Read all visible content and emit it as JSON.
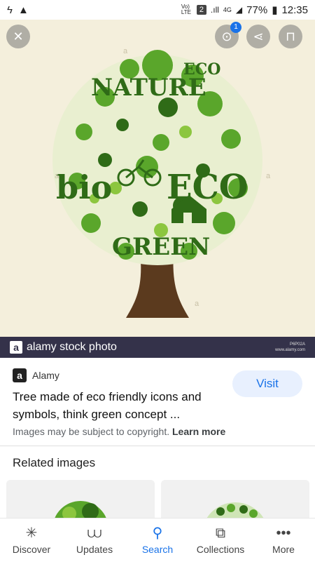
{
  "status_bar": {
    "time": "12:35",
    "battery": "77%",
    "network": "4G",
    "volte": "Vo) LTE",
    "sim_slot": "2"
  },
  "viewer": {
    "close_icon": "close-icon",
    "lens_badge": "1",
    "watermark_text": "a",
    "watermark_brand": "alamy stock photo",
    "watermark_id": "P6P02A",
    "watermark_url": "www.alamy.com",
    "art": {
      "words": [
        "NATURE",
        "ECO",
        "bio",
        "ECO",
        "GREEN"
      ],
      "colors": {
        "leaf_dark": "#2f6b17",
        "leaf_mid": "#5aa62b",
        "leaf_light": "#8cc63f",
        "trunk": "#5b3a1e",
        "background": "#f4efdc"
      }
    }
  },
  "result": {
    "source_letter": "a",
    "source_name": "Alamy",
    "title": "Tree made of eco friendly icons and symbols, think green concept ...",
    "visit_label": "Visit",
    "copyright_text": "Images may be subject to copyright.",
    "learn_more": "Learn more"
  },
  "related": {
    "heading": "Related images"
  },
  "bottom_nav": [
    {
      "label": "Discover",
      "icon": "asterisk-icon",
      "active": false
    },
    {
      "label": "Updates",
      "icon": "updates-icon",
      "active": false
    },
    {
      "label": "Search",
      "icon": "search-icon",
      "active": true
    },
    {
      "label": "Collections",
      "icon": "collections-icon",
      "active": false
    },
    {
      "label": "More",
      "icon": "more-icon",
      "active": false
    }
  ],
  "accent_color": "#1a73e8"
}
